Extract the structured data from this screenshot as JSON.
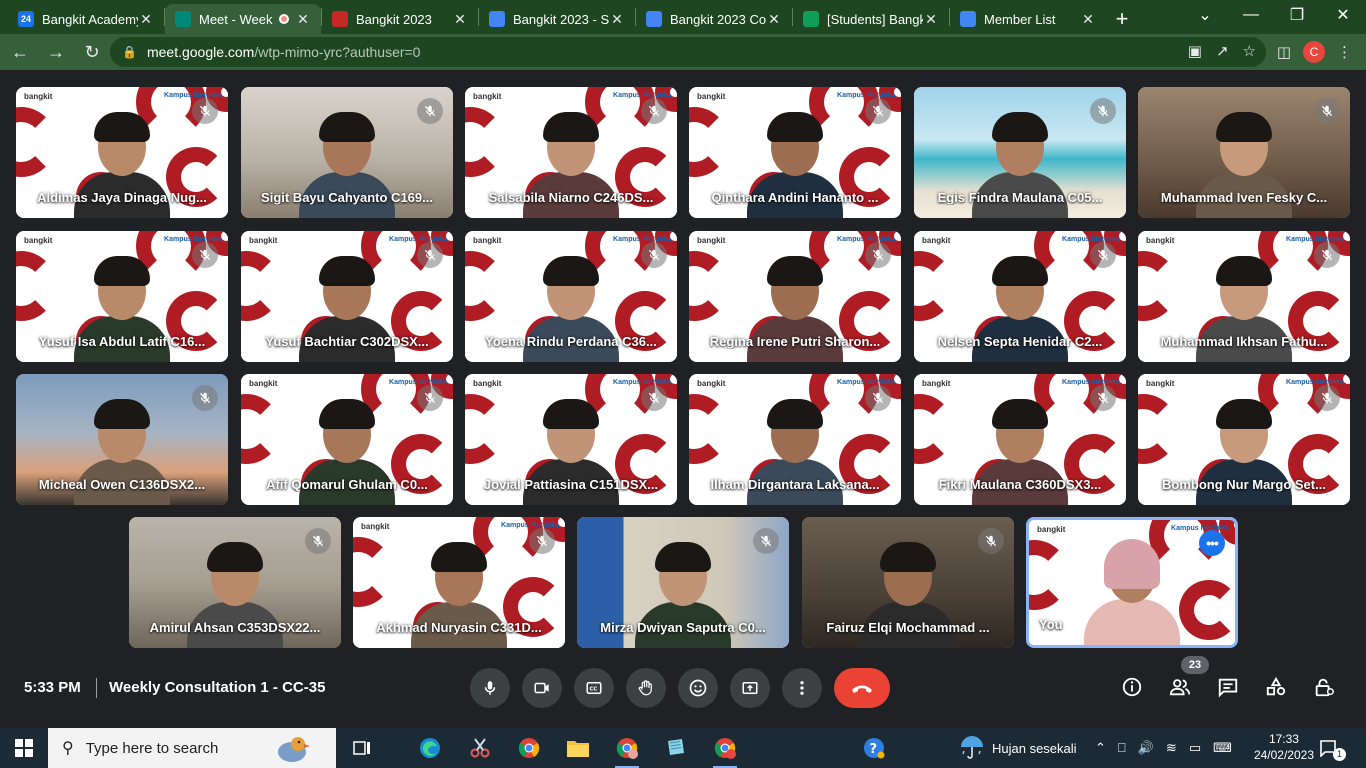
{
  "browser": {
    "tabs": [
      {
        "label": "Bangkit Academy",
        "icon": "calendar-icon",
        "color": "#1a73e8",
        "badge": "24"
      },
      {
        "label": "Meet - Week",
        "icon": "meet-icon",
        "color": "#00897b",
        "active": true,
        "recording": true
      },
      {
        "label": "Bangkit 2023",
        "icon": "bangkit-icon",
        "color": "#c62828"
      },
      {
        "label": "Bangkit 2023 - St",
        "icon": "docs-icon",
        "color": "#4285f4"
      },
      {
        "label": "Bangkit 2023 Co",
        "icon": "docs-icon",
        "color": "#4285f4"
      },
      {
        "label": "[Students] Bangk",
        "icon": "sheets-icon",
        "color": "#0f9d58"
      },
      {
        "label": "Member List",
        "icon": "people-icon",
        "color": "#4285f4"
      }
    ],
    "url_host": "meet.google.com",
    "url_path": "/wtp-mimo-yrc?authuser=0",
    "profile_initial": "C"
  },
  "participants": [
    {
      "name": "Aldimas Jaya Dinaga Nug...",
      "bg": "brand"
    },
    {
      "name": "Sigit Bayu Cahyanto C169...",
      "bg": "room"
    },
    {
      "name": "Salsabila Niarno C246DS...",
      "bg": "brand"
    },
    {
      "name": "Qinthara Andini Hananto ...",
      "bg": "brand"
    },
    {
      "name": "Egis Findra Maulana C05...",
      "bg": "beach"
    },
    {
      "name": "Muhammad Iven Fesky C...",
      "bg": "room2"
    },
    {
      "name": "Yusuf Isa Abdul Latif C16...",
      "bg": "brand"
    },
    {
      "name": "Yusuf Bachtiar C302DSX...",
      "bg": "brand"
    },
    {
      "name": "Yoena Rindu Perdana C36...",
      "bg": "brand"
    },
    {
      "name": "Regina Irene Putri Sharon...",
      "bg": "brand"
    },
    {
      "name": "Nelsen Septa Henidar C2...",
      "bg": "brand"
    },
    {
      "name": "Muhammad Ikhsan Fathu...",
      "bg": "brand"
    },
    {
      "name": "Micheal Owen C136DSX2...",
      "bg": "sunset"
    },
    {
      "name": "Afif Qomarul Ghulam C0...",
      "bg": "brand"
    },
    {
      "name": "Jovial Pattiasina C151DSX...",
      "bg": "brand"
    },
    {
      "name": "Ilham Dirgantara Laksana...",
      "bg": "brand"
    },
    {
      "name": "Fikri Maulana C360DSX3...",
      "bg": "brand"
    },
    {
      "name": "Bombong Nur Margo Set...",
      "bg": "brand"
    },
    {
      "name": "Amirul Ahsan C353DSX22...",
      "bg": "cafe"
    },
    {
      "name": "Akhmad Nuryasin C331D...",
      "bg": "brand"
    },
    {
      "name": "Mirza Dwiyan Saputra C0...",
      "bg": "bedroom"
    },
    {
      "name": "Fairuz Elqi Mochammad ...",
      "bg": "dark"
    },
    {
      "name": "You",
      "bg": "brand",
      "self": true
    }
  ],
  "brand": {
    "logo_left": "bangkit",
    "logo_right": "Kampus Merdeka",
    "accent": "#b01c24"
  },
  "meeting": {
    "time": "5:33 PM",
    "title": "Weekly Consultation 1 - CC-35",
    "participant_count": "23",
    "hangup_color": "#ea4335",
    "controls": [
      "microphone-icon",
      "camera-icon",
      "captions-icon",
      "raise-hand-icon",
      "emoji-icon",
      "present-icon",
      "more-options-icon"
    ],
    "right_controls": [
      "info-icon",
      "people-icon",
      "chat-icon",
      "activities-icon",
      "host-controls-icon"
    ]
  },
  "taskbar": {
    "search_placeholder": "Type here to search",
    "weather": "Hujan sesekali",
    "clock_time": "17:33",
    "clock_date": "24/02/2023",
    "notification_count": "1"
  }
}
